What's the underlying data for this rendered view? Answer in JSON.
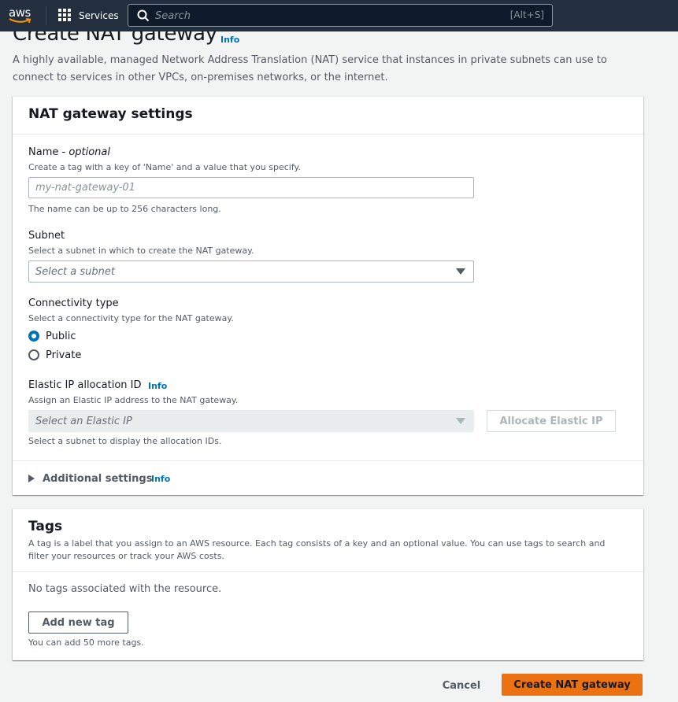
{
  "topnav": {
    "logo_text": "aws",
    "services_label": "Services",
    "search_placeholder": "Search",
    "search_shortcut": "[Alt+S]"
  },
  "page": {
    "title": "Create NAT gateway",
    "title_info": "Info",
    "description": "A highly available, managed Network Address Translation (NAT) service that instances in private subnets can use to connect to services in other VPCs, on-premises networks, or the internet."
  },
  "settings": {
    "title": "NAT gateway settings",
    "name": {
      "label": "Name - ",
      "label_optional": "optional",
      "description": "Create a tag with a key of 'Name' and a value that you specify.",
      "placeholder": "my-nat-gateway-01",
      "value": "",
      "constraint": "The name can be up to 256 characters long."
    },
    "subnet": {
      "label": "Subnet",
      "description": "Select a subnet in which to create the NAT gateway.",
      "placeholder": "Select a subnet"
    },
    "connectivity": {
      "label": "Connectivity type",
      "description": "Select a connectivity type for the NAT gateway.",
      "options": [
        {
          "label": "Public",
          "checked": true
        },
        {
          "label": "Private",
          "checked": false
        }
      ]
    },
    "elastic_ip": {
      "label": "Elastic IP allocation ID",
      "info": "Info",
      "description": "Assign an Elastic IP address to the NAT gateway.",
      "placeholder": "Select an Elastic IP",
      "allocate_button": "Allocate Elastic IP",
      "constraint": "Select a subnet to display the allocation IDs."
    },
    "additional": {
      "label": "Additional settings",
      "info": "Info"
    }
  },
  "tags": {
    "title": "Tags",
    "description": "A tag is a label that you assign to an AWS resource. Each tag consists of a key and an optional value. You can use tags to search and filter your resources or track your AWS costs.",
    "empty_text": "No tags associated with the resource.",
    "add_button": "Add new tag",
    "limit_text": "You can add 50 more tags."
  },
  "footer": {
    "cancel_label": "Cancel",
    "create_label": "Create NAT gateway"
  },
  "colors": {
    "nav_bg": "#232f3e",
    "primary": "#ec7211",
    "link": "#0073bb",
    "page_bg": "#f2f3f3"
  }
}
